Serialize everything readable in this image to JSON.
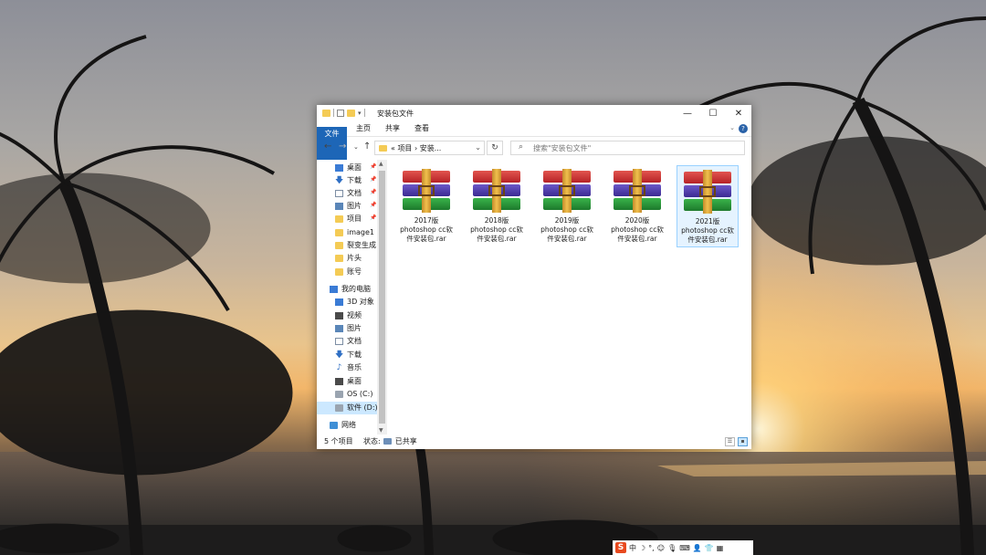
{
  "window": {
    "title": "安装包文件",
    "controls": {
      "minimize": "—",
      "maximize": "☐",
      "close": "✕"
    }
  },
  "ribbon": {
    "tabs": [
      "文件",
      "主页",
      "共享",
      "查看"
    ],
    "help": "?"
  },
  "address": {
    "crumbs": "« 项目 › 安装...",
    "search_placeholder": "搜索\"安装包文件\""
  },
  "nav": {
    "quick_access": [
      {
        "label": "桌面",
        "icon": "desktop-icon",
        "pinned": true
      },
      {
        "label": "下载",
        "icon": "download-icon",
        "pinned": true
      },
      {
        "label": "文档",
        "icon": "document-icon",
        "pinned": true
      },
      {
        "label": "图片",
        "icon": "picture-icon",
        "pinned": true
      },
      {
        "label": "项目",
        "icon": "folder-icon",
        "pinned": true
      },
      {
        "label": "image1",
        "icon": "folder-icon",
        "pinned": false
      },
      {
        "label": "裂变生成",
        "icon": "folder-icon",
        "pinned": false
      },
      {
        "label": "片头",
        "icon": "folder-icon",
        "pinned": false
      },
      {
        "label": "账号",
        "icon": "folder-icon",
        "pinned": false
      }
    ],
    "this_pc": "我的电脑",
    "this_pc_items": [
      {
        "label": "3D 对象",
        "icon": "3d-objects-icon"
      },
      {
        "label": "视频",
        "icon": "video-icon"
      },
      {
        "label": "图片",
        "icon": "picture-icon"
      },
      {
        "label": "文档",
        "icon": "document-icon"
      },
      {
        "label": "下载",
        "icon": "download-icon"
      },
      {
        "label": "音乐",
        "icon": "music-icon"
      },
      {
        "label": "桌面",
        "icon": "desktop-icon"
      },
      {
        "label": "OS (C:)",
        "icon": "drive-icon"
      },
      {
        "label": "软件 (D:)",
        "icon": "drive-icon",
        "selected": true
      }
    ],
    "network": "网络"
  },
  "files": [
    {
      "line1": "2017版",
      "line2": "photoshop cc软",
      "line3": "件安装包.rar",
      "selected": false
    },
    {
      "line1": "2018版",
      "line2": "photoshop cc软",
      "line3": "件安装包.rar",
      "selected": false
    },
    {
      "line1": "2019版",
      "line2": "photoshop cc软",
      "line3": "件安装包.rar",
      "selected": false
    },
    {
      "line1": "2020版",
      "line2": "photoshop cc软",
      "line3": "件安装包.rar",
      "selected": false
    },
    {
      "line1": "2021版",
      "line2": "photoshop cc软",
      "line3": "件安装包.rar",
      "selected": true
    }
  ],
  "status": {
    "count": "5 个项目",
    "state_label": "状态:",
    "state_value": "已共享"
  },
  "ime": {
    "mode": "中",
    "icon": "S"
  }
}
